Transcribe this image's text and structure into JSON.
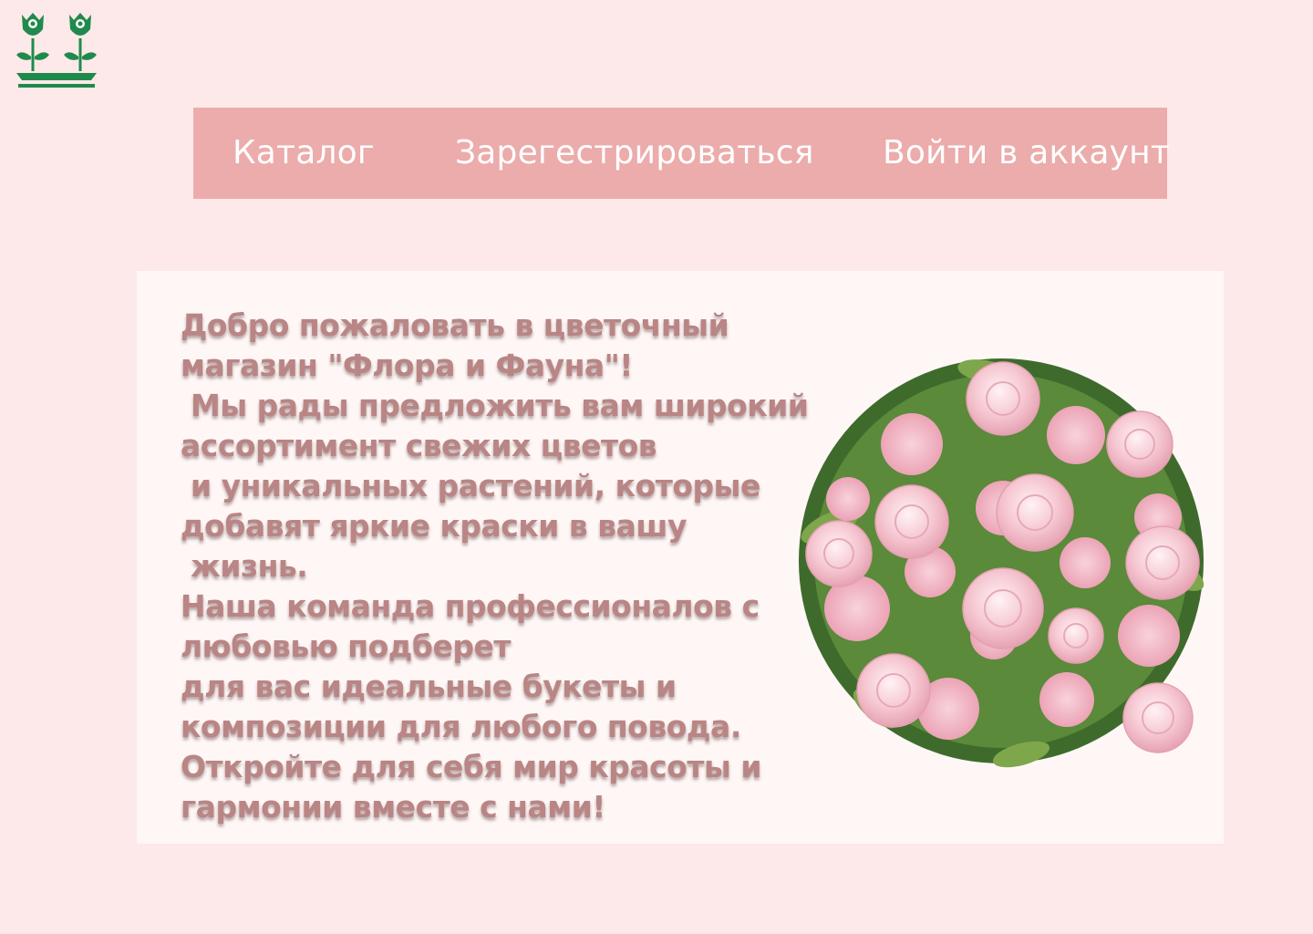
{
  "logo": {
    "icon": "rose-pair-logo-icon",
    "color": "#1f8a4c"
  },
  "nav": {
    "background": "#ebacab",
    "items": [
      {
        "label": "Каталог"
      },
      {
        "label": "Зарегестрироваться"
      },
      {
        "label": "Войти в аккаунт"
      }
    ]
  },
  "welcome": {
    "text_color": "#b98585",
    "text": "Добро пожаловать в цветочный\nмагазин \"Флора и Фауна\"!\n Мы рады предложить вам широкий\nассортимент свежих цветов\n и уникальных растений, которые\nдобавят яркие краски в вашу\n жизнь.\nНаша команда профессионалов с\nлюбовью подберет\nдля вас идеальные букеты и\nкомпозиции для любого повода.\nОткройте для себя мир красоты и\nгармонии вместе с нами!"
  },
  "bouquet": {
    "icon": "pink-roses-bouquet-image"
  }
}
